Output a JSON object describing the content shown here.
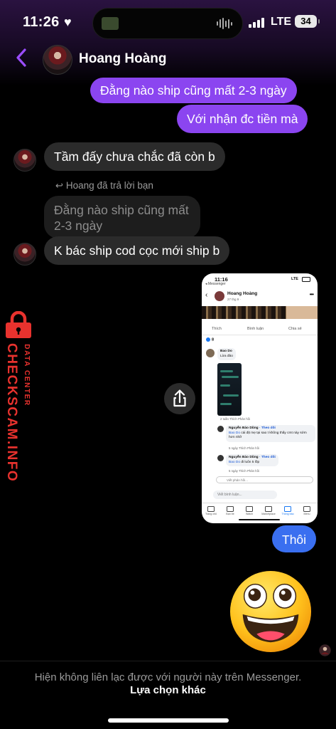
{
  "status_bar": {
    "time": "11:26",
    "network": "LTE",
    "battery": "34"
  },
  "header": {
    "contact_name": "Hoang Hoàng"
  },
  "messages": {
    "m1": "Đằng nào ship cũng mất 2-3 ngày",
    "m2": "Với nhận đc tiền mà",
    "m3": "Tầm đấy chưa chắc đã còn b",
    "reply_note": "Hoang đã trả lời bạn",
    "quoted": "Đằng nào ship cũng mất 2-3 ngày",
    "m4": "K bác ship cod cọc mới ship b",
    "m5": "Thôi"
  },
  "watermark": {
    "main": "CHECKSCAM.INFO",
    "sub": "DATA CENTER"
  },
  "shared_screenshot": {
    "time": "11:16",
    "back_label": "◂ Messenger",
    "network": "LTE",
    "name": "Hoang Hoàng",
    "date": "27 thg 9 ·",
    "like": "Thích",
    "comment": "Bình luận",
    "share": "Chia sẻ",
    "reaction_count": "8",
    "c1_name": "Bao Do",
    "c1_text": "Lừa đảo",
    "c1_meta": "2 tuần   Thích   Phản hồi",
    "c2_name": "Nguyễn Bảo Dũng",
    "c2_follow": "· Theo dõi",
    "c2_tag": "Bao Do",
    "c2_text": "cái địt mẹ tại sao t không thấy cmt này sớm hơn nhỡ",
    "c2_meta": "5 ngày   Thích   Phản hồi",
    "c3_name": "Nguyễn Bảo Dũng",
    "c3_follow": "· Theo dõi",
    "c3_tag": "Bao Do",
    "c3_text": "đi luôn 5 lốp",
    "c3_meta": "5 ngày   Thích   Phản hồi",
    "reply_placeholder": "Viết phản hồi...",
    "comment_placeholder": "Viết bình luận...",
    "tabs": [
      "Trang chủ",
      "Bạn bè",
      "Watch",
      "Marketplace",
      "Thông báo",
      "Menu"
    ]
  },
  "footer": {
    "note": "Hiện không liên lạc được với người này trên Messenger.",
    "link": "Lựa chọn khác"
  },
  "colors": {
    "accent_purple": "#8b45f0",
    "sent_blue": "#3a6ff0",
    "received_gray": "#2b2b2b",
    "watermark_red": "#e8322e"
  }
}
